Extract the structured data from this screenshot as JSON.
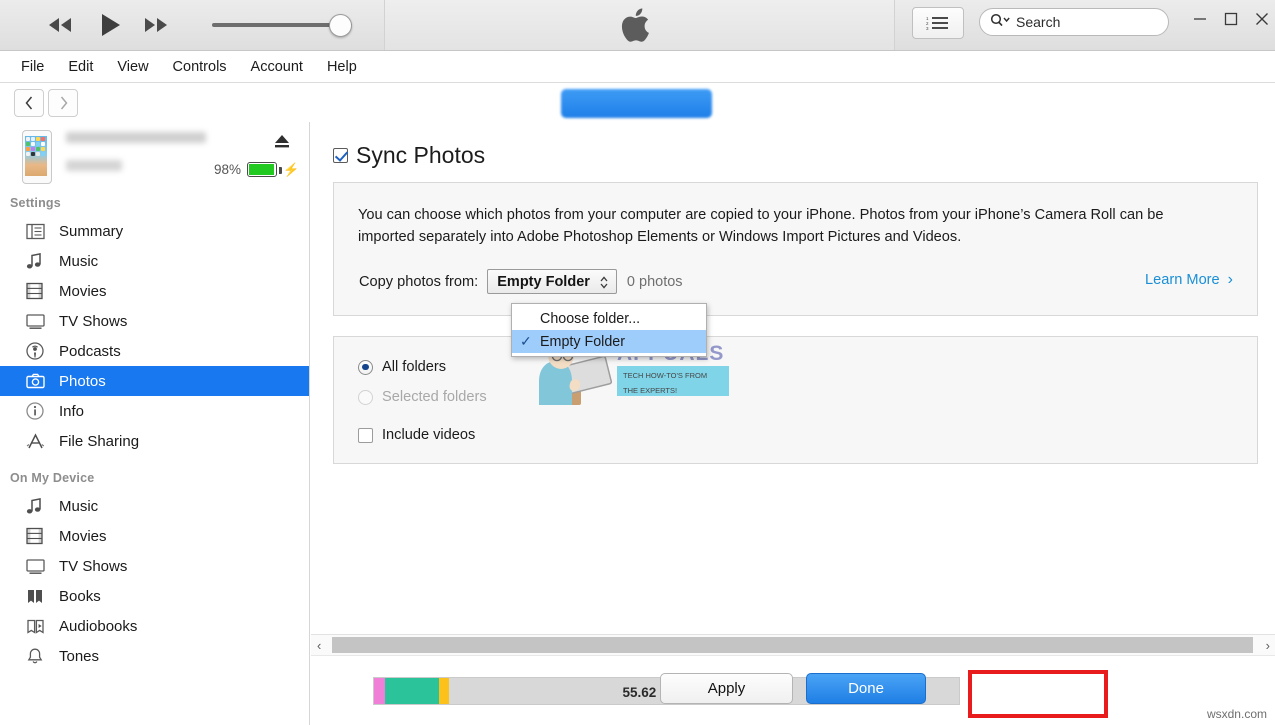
{
  "titlebar": {
    "controls": {
      "previous": "previous-track",
      "play": "play",
      "next": "next-track"
    },
    "volume_value": 92,
    "apple_logo": "apple-logo",
    "list_view_button": "list-view",
    "search": {
      "placeholder": "Search",
      "icon": "search-icon",
      "chevron": "chevron-down-icon"
    },
    "window": {
      "minimize": "—",
      "maximize": "☐",
      "close": "✕"
    }
  },
  "menubar": {
    "items": [
      {
        "label": "File"
      },
      {
        "label": "Edit"
      },
      {
        "label": "View"
      },
      {
        "label": "Controls"
      },
      {
        "label": "Account"
      },
      {
        "label": "Help"
      }
    ]
  },
  "navbar": {
    "back": "‹",
    "forward": "›"
  },
  "sidebar": {
    "device": {
      "battery_percent": "98%",
      "charging": true,
      "eject": "eject-icon"
    },
    "settings_header": "Settings",
    "settings_items": [
      {
        "label": "Summary",
        "icon": "summary-icon"
      },
      {
        "label": "Music",
        "icon": "music-note-icon"
      },
      {
        "label": "Movies",
        "icon": "film-icon"
      },
      {
        "label": "TV Shows",
        "icon": "tv-icon"
      },
      {
        "label": "Podcasts",
        "icon": "podcast-icon"
      },
      {
        "label": "Photos",
        "icon": "camera-icon"
      },
      {
        "label": "Info",
        "icon": "info-icon"
      },
      {
        "label": "File Sharing",
        "icon": "file-sharing-icon"
      }
    ],
    "active_item": "Photos",
    "device_header": "On My Device",
    "device_items": [
      {
        "label": "Music",
        "icon": "music-note-icon"
      },
      {
        "label": "Movies",
        "icon": "film-icon"
      },
      {
        "label": "TV Shows",
        "icon": "tv-icon"
      },
      {
        "label": "Books",
        "icon": "books-icon"
      },
      {
        "label": "Audiobooks",
        "icon": "audiobook-icon"
      },
      {
        "label": "Tones",
        "icon": "bell-icon"
      }
    ]
  },
  "main": {
    "sync_photos_label": "Sync Photos",
    "sync_photos_checked": true,
    "description": "You can choose which photos from your computer are copied to your iPhone. Photos from your iPhone’s Camera Roll can be imported separately into Adobe Photoshop Elements or Windows Import Pictures and Videos.",
    "copy_from_label": "Copy photos from:",
    "selected_folder": "Empty Folder",
    "photo_count": "0 photos",
    "learn_more": "Learn More",
    "learn_more_chevron": "›",
    "dropdown": {
      "open": true,
      "options": [
        {
          "label": "Choose folder...",
          "selected": false
        },
        {
          "label": "Empty Folder",
          "selected": true
        }
      ],
      "check_glyph": "✓"
    },
    "options": {
      "all_folders": "All folders",
      "all_folders_selected": true,
      "selected_folders": "Selected folders",
      "selected_folders_disabled": true,
      "include_videos": "Include videos",
      "include_videos_checked": false
    }
  },
  "watermark": {
    "brand": "APPUALS",
    "tagline_line1": "TECH HOW-TO'S FROM",
    "tagline_line2": "THE EXPERTS!",
    "site": "wsxdn.com"
  },
  "bottombar": {
    "free_space": "55.62 GB Free",
    "capacity_segments": [
      {
        "name": "photos",
        "color": "#f07fd8",
        "width": 11
      },
      {
        "name": "apps",
        "color": "#2bc49a",
        "width": 54
      },
      {
        "name": "other",
        "color": "#fcc11a",
        "width": 10
      }
    ],
    "apply_label": "Apply",
    "done_label": "Done"
  },
  "colors": {
    "accent_blue": "#1878f0",
    "link_blue": "#1a8fd6",
    "highlight_red": "#e81c1c",
    "battery_green": "#22c921"
  }
}
